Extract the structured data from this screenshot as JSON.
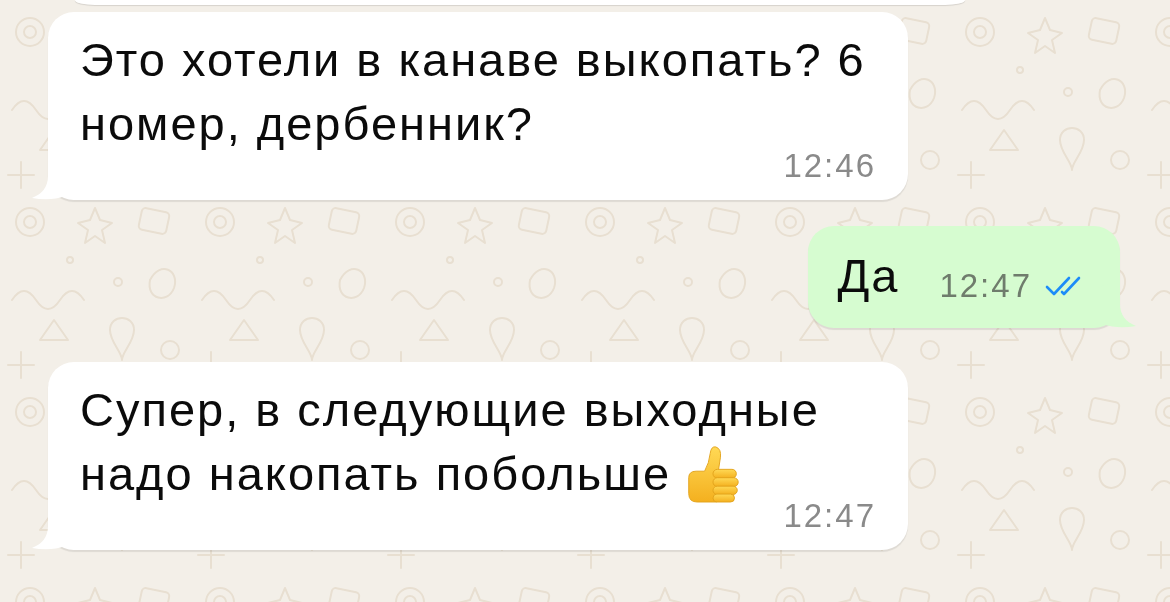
{
  "messages": [
    {
      "kind": "incoming",
      "text": "Это хотели в канаве выкопать? 6 номер, дербенник?",
      "time": "12:46"
    },
    {
      "kind": "outgoing",
      "text": "Да",
      "time": "12:47",
      "read": true
    },
    {
      "kind": "incoming",
      "text": "Супер, в следующие выходные надо накопать побольше",
      "emoji": true,
      "time": "12:47"
    }
  ]
}
